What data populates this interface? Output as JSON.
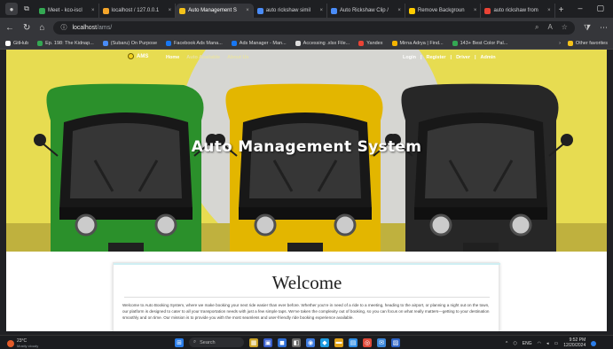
{
  "browser": {
    "tabs": [
      {
        "label": "Meet - kco-iscl",
        "color": "#34a853"
      },
      {
        "label": "localhost / 127.0.0.1",
        "color": "#f4a52a"
      },
      {
        "label": "Auto Management S",
        "color": "#f4c21a",
        "active": true
      },
      {
        "label": "auto rickshaw simil",
        "color": "#4a8cf7"
      },
      {
        "label": "Auto Rickshaw Clip /",
        "color": "#4a8cf7"
      },
      {
        "label": "Remove Backgroun",
        "color": "#ffcc00"
      },
      {
        "label": "auto rickshaw from",
        "color": "#ea4335"
      }
    ],
    "new_tab": "+",
    "address": {
      "host": "localhost",
      "path": "/ams/"
    },
    "bookmarks": [
      {
        "label": "GitHub",
        "color": "#ffffff"
      },
      {
        "label": "Ep. 198: The Kidnap...",
        "color": "#34a853"
      },
      {
        "label": "(Subaru) On Purpose",
        "color": "#4a8cf7"
      },
      {
        "label": "Facebook Ads Mana...",
        "color": "#1877f2"
      },
      {
        "label": "Ads Manager - Man...",
        "color": "#1877f2"
      },
      {
        "label": "Accessing .xlsx File...",
        "color": "#dddddd"
      },
      {
        "label": "Yandex",
        "color": "#ea4335"
      },
      {
        "label": "Mirna Adrya | Find...",
        "color": "#f4b400"
      },
      {
        "label": "143+ Best Color Pal...",
        "color": "#34a853"
      }
    ],
    "other_bookmarks": "Other favorites"
  },
  "site": {
    "brand": "AMS",
    "nav": {
      "home": "Home",
      "available": "Auto Available",
      "about": "About Us"
    },
    "auth": {
      "login": "Login",
      "register": "Register",
      "driver": "Driver",
      "admin": "Admin",
      "sep": "|"
    },
    "hero_title": "Auto Management System",
    "welcome_title": "Welcome",
    "welcome_text": "Welcome to Auto Booking System, where we make booking your next ride easier than ever before. Whether you're in need of a ride to a meeting, heading to the airport, or planning a night out on the town, our platform is designed to cater to all your transportation needs with just a few simple taps. We've taken the complexity out of booking, so you can focus on what really matters—getting to your destination smoothly and on time. Our mission is to provide you with the most seamless and user-friendly ride booking experience available.",
    "colors": {
      "hero_bg": "#f6ea57",
      "rickshaw_green": "#2e9a2e",
      "rickshaw_yellow": "#f2c200",
      "rickshaw_black": "#2a2a2a"
    }
  },
  "taskbar": {
    "temp": "23°C",
    "weather": "Mostly cloudy",
    "search": "Search",
    "lang": "ENG",
    "time": "9:52 PM",
    "date": "12/20/2024"
  }
}
